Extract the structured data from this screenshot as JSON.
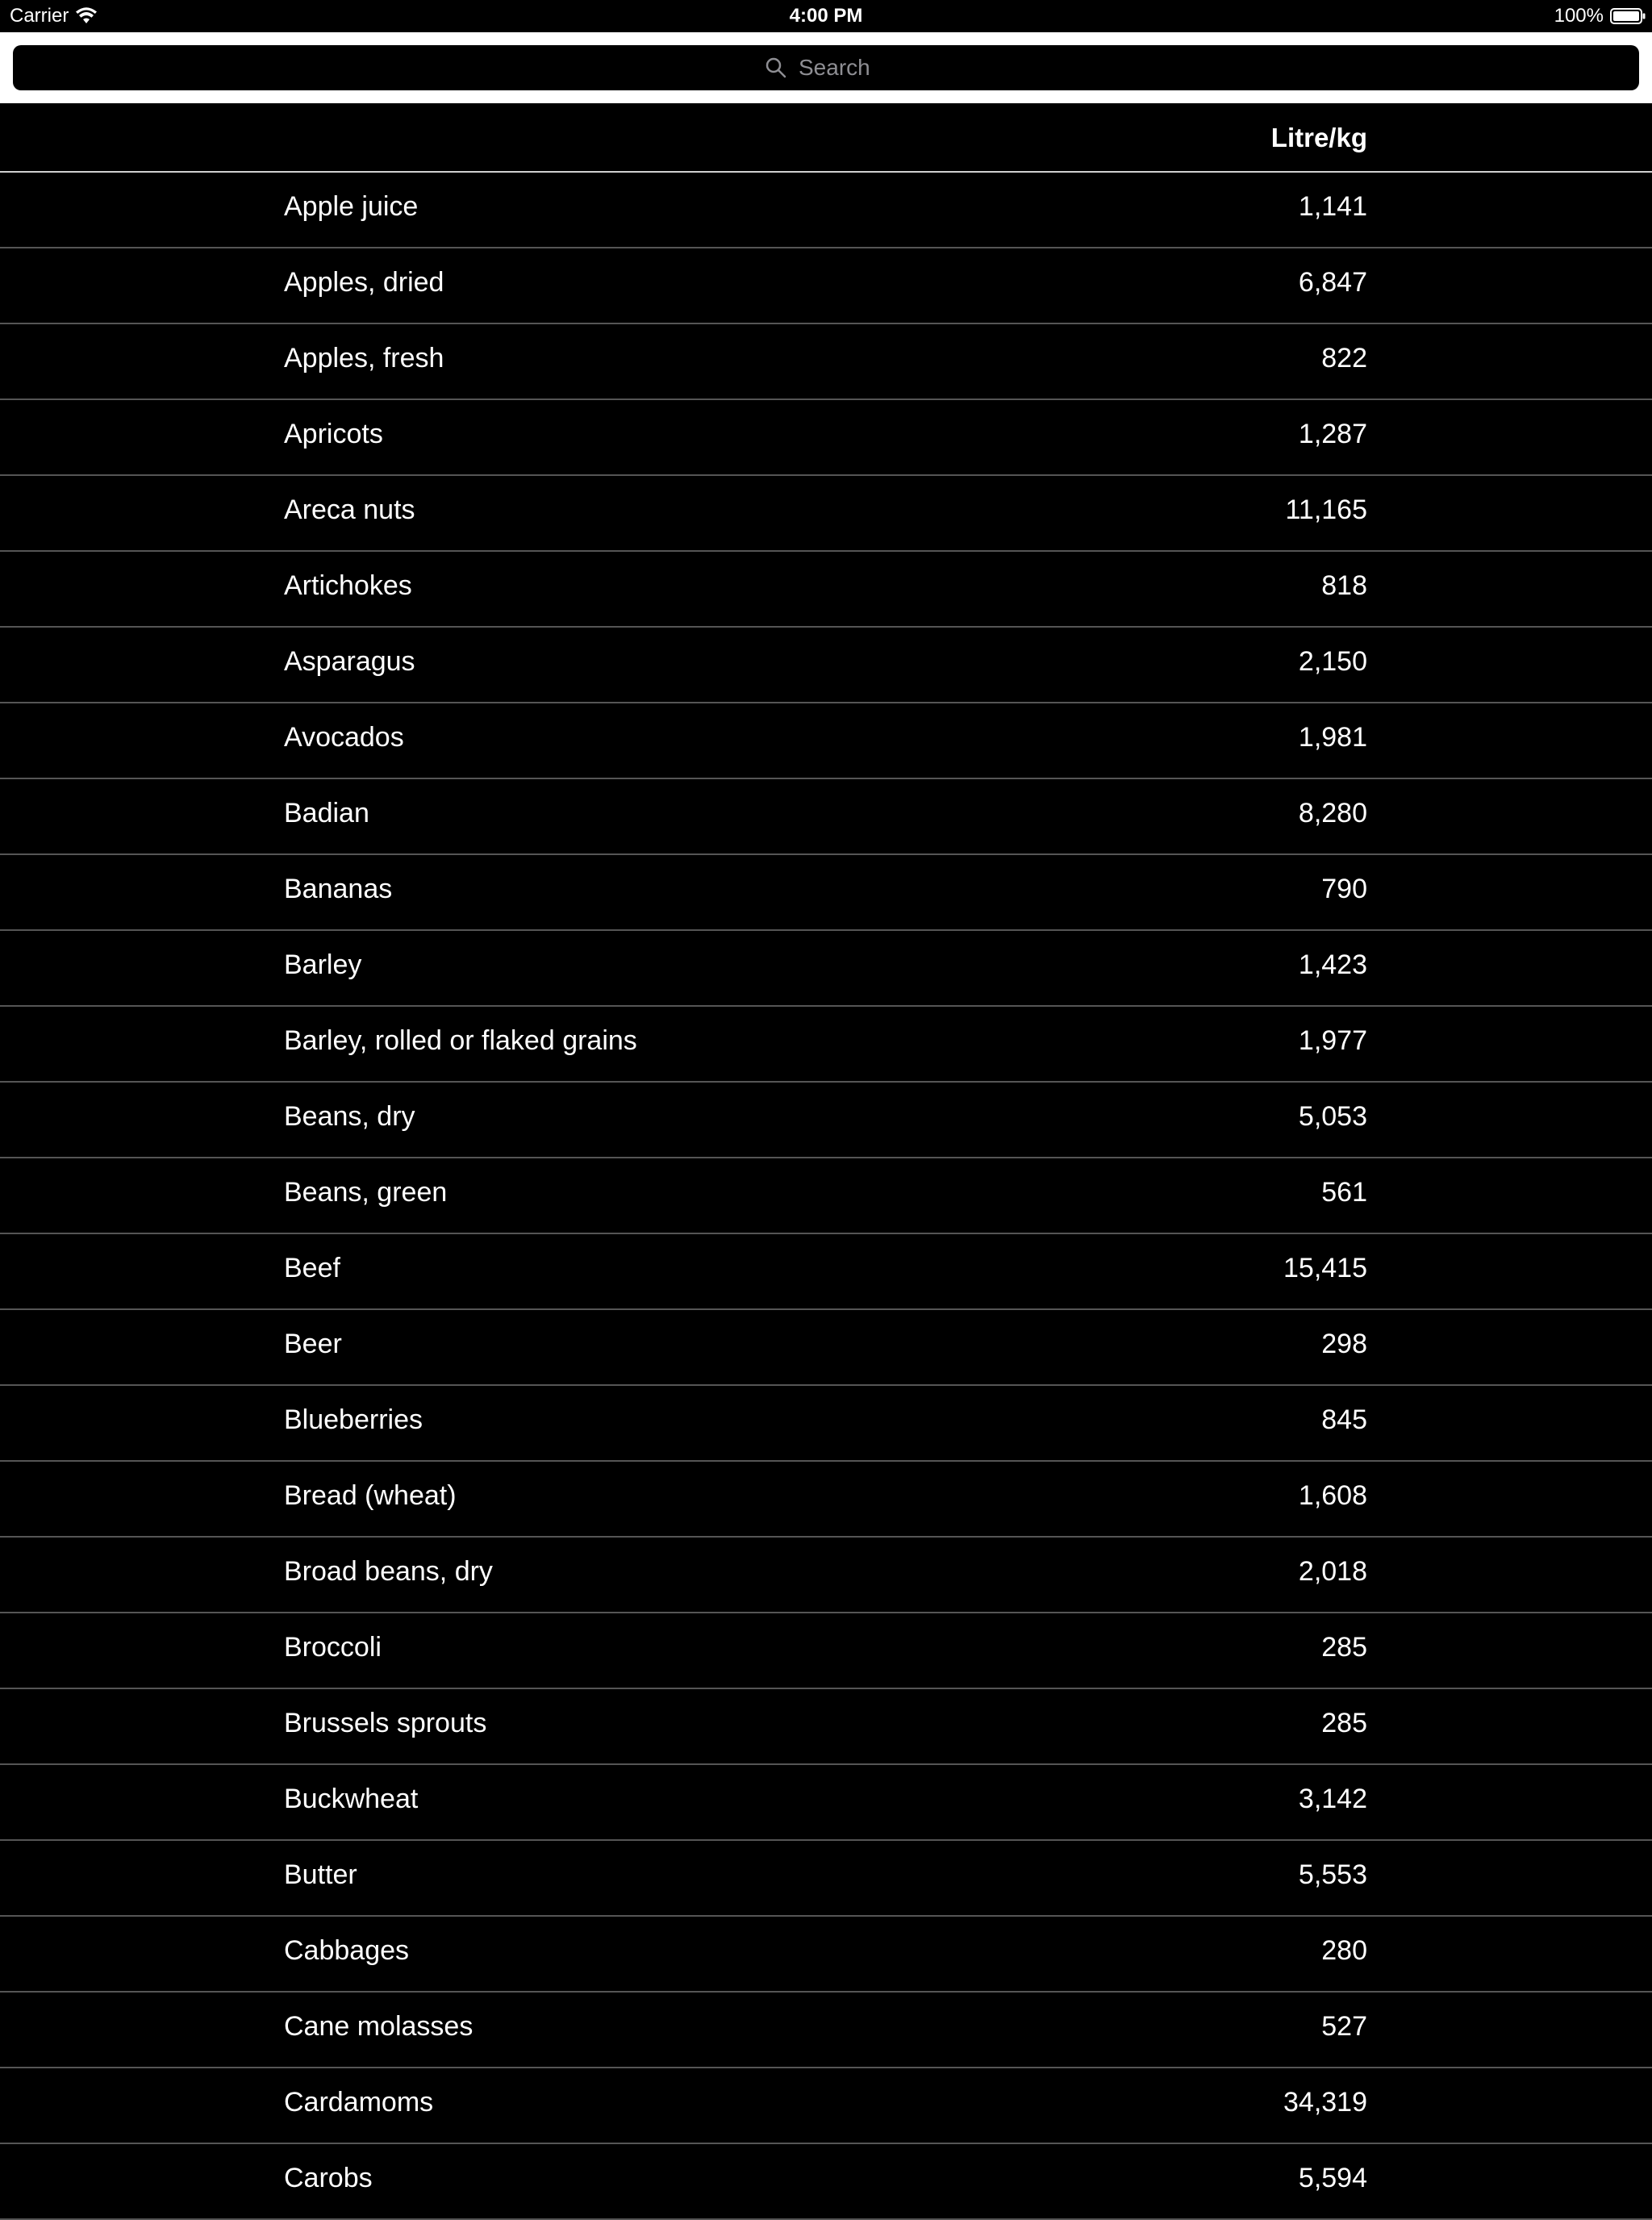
{
  "status_bar": {
    "carrier": "Carrier",
    "time": "4:00 PM",
    "battery": "100%"
  },
  "search": {
    "placeholder": "Search"
  },
  "table": {
    "value_header": "Litre/kg",
    "rows": [
      {
        "name": "Apple juice",
        "value": "1,141"
      },
      {
        "name": "Apples, dried",
        "value": "6,847"
      },
      {
        "name": "Apples, fresh",
        "value": "822"
      },
      {
        "name": "Apricots",
        "value": "1,287"
      },
      {
        "name": "Areca nuts",
        "value": "11,165"
      },
      {
        "name": "Artichokes",
        "value": "818"
      },
      {
        "name": "Asparagus",
        "value": "2,150"
      },
      {
        "name": "Avocados",
        "value": "1,981"
      },
      {
        "name": "Badian",
        "value": "8,280"
      },
      {
        "name": "Bananas",
        "value": "790"
      },
      {
        "name": "Barley",
        "value": "1,423"
      },
      {
        "name": "Barley, rolled or flaked grains",
        "value": "1,977"
      },
      {
        "name": "Beans, dry",
        "value": "5,053"
      },
      {
        "name": "Beans, green",
        "value": "561"
      },
      {
        "name": "Beef",
        "value": "15,415"
      },
      {
        "name": "Beer",
        "value": "298"
      },
      {
        "name": "Blueberries",
        "value": "845"
      },
      {
        "name": "Bread (wheat)",
        "value": "1,608"
      },
      {
        "name": "Broad beans, dry",
        "value": "2,018"
      },
      {
        "name": "Broccoli",
        "value": "285"
      },
      {
        "name": "Brussels sprouts",
        "value": "285"
      },
      {
        "name": "Buckwheat",
        "value": "3,142"
      },
      {
        "name": "Butter",
        "value": "5,553"
      },
      {
        "name": "Cabbages",
        "value": "280"
      },
      {
        "name": "Cane molasses",
        "value": "527"
      },
      {
        "name": "Cardamoms",
        "value": "34,319"
      },
      {
        "name": "Carobs",
        "value": "5,594"
      }
    ]
  }
}
